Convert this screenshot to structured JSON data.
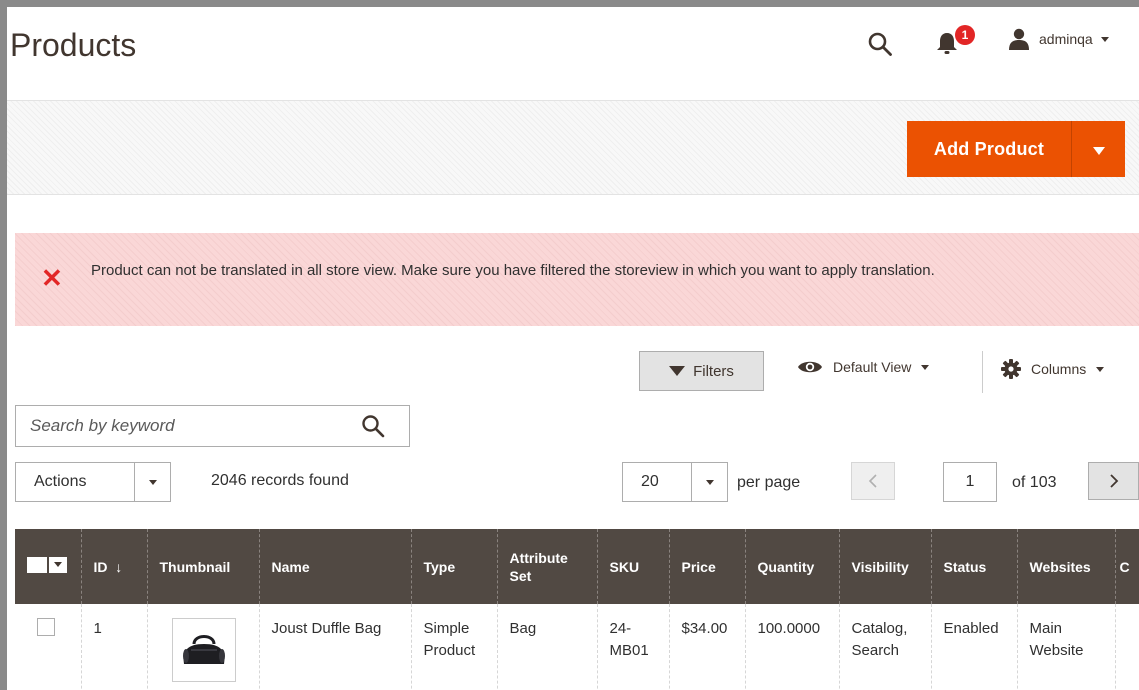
{
  "header": {
    "title": "Products",
    "notifications_count": "1",
    "username": "adminqa"
  },
  "action_bar": {
    "add_product_label": "Add Product"
  },
  "message": {
    "text": "Product can not be translated in all store view. Make sure you have filtered the storeview in which you want to apply translation."
  },
  "toolbar": {
    "filters_label": "Filters",
    "view_label": "Default View",
    "columns_label": "Columns",
    "search_placeholder": "Search by keyword",
    "actions_label": "Actions",
    "records_found": "2046 records found",
    "per_page_value": "20",
    "per_page_label": "per page",
    "current_page": "1",
    "total_pages": "of 103"
  },
  "colors": {
    "accent": "#eb5202",
    "table_header": "#514943",
    "error_bg": "#fad7d7",
    "error_icon": "#e22626"
  },
  "table": {
    "columns": [
      "ID",
      "Thumbnail",
      "Name",
      "Type",
      "Attribute Set",
      "SKU",
      "Price",
      "Quantity",
      "Visibility",
      "Status",
      "Websites",
      "C"
    ],
    "sort_indicator": "↓",
    "rows": [
      {
        "id": "1",
        "name": "Joust Duffle Bag",
        "type": "Simple Product",
        "attribute_set": "Bag",
        "sku": "24-MB01",
        "price": "$34.00",
        "quantity": "100.0000",
        "visibility": "Catalog, Search",
        "status": "Enabled",
        "websites": "Main Website"
      }
    ]
  }
}
